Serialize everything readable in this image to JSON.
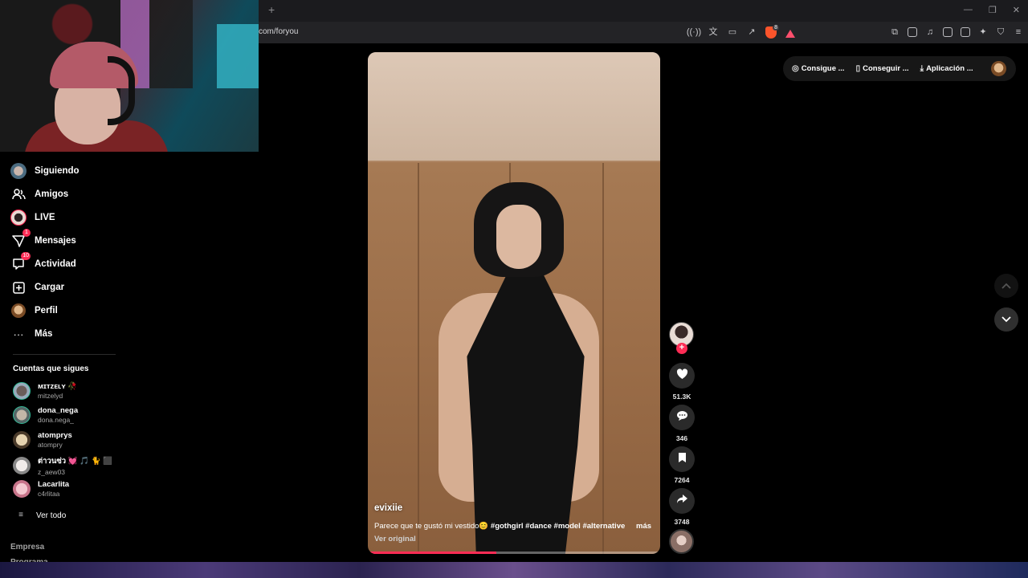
{
  "browser": {
    "new_tab": "+",
    "url": "com/foryou",
    "window_controls": [
      "—",
      "❐",
      "✕"
    ],
    "shields_badge": "8"
  },
  "sidebar": {
    "nav": [
      {
        "label": "Siguiendo",
        "icon": "avatar-icon"
      },
      {
        "label": "Amigos",
        "icon": "friends-icon"
      },
      {
        "label": "LIVE",
        "icon": "live-avatar-icon"
      },
      {
        "label": "Mensajes",
        "icon": "messages-icon",
        "badge": "1"
      },
      {
        "label": "Actividad",
        "icon": "activity-icon",
        "badge": "10"
      },
      {
        "label": "Cargar",
        "icon": "upload-icon"
      },
      {
        "label": "Perfil",
        "icon": "profile-avatar-icon"
      },
      {
        "label": "Más",
        "icon": "more-icon"
      }
    ],
    "following_title": "Cuentas que sigues",
    "accounts": [
      {
        "name": "ᴍɪᴛᴢᴇʟʏ 🥀",
        "handle": "mitzelyd"
      },
      {
        "name": "dona_nega",
        "handle": "dona.nega_"
      },
      {
        "name": "atomprys",
        "handle": "atompry"
      },
      {
        "name": "ต่าวนซ่ว 💓 🎵 🐈 ⬛",
        "handle": "z_aew03"
      },
      {
        "name": "Lacarlita",
        "handle": "c4rlitaa"
      }
    ],
    "see_all": "Ver todo",
    "footer": [
      "Empresa",
      "Programa"
    ]
  },
  "video": {
    "username": "evixiie",
    "caption": "Parece que te gustó mi vestido😊 ",
    "hashtags": "#gothgirl #dance #model #alternative",
    "more": "más",
    "original": "Ver original",
    "progress": 0.44
  },
  "actions": {
    "follow": "+",
    "likes": "51.3K",
    "comments": "346",
    "saves": "7264",
    "shares": "3748"
  },
  "top_bar": {
    "coins": "Consigue ...",
    "app_get": "Conseguir ...",
    "download": "Aplicación ..."
  },
  "colors": {
    "accent": "#fe2c55",
    "background": "#000000",
    "sidebar_divider": "#2b2b2b"
  }
}
